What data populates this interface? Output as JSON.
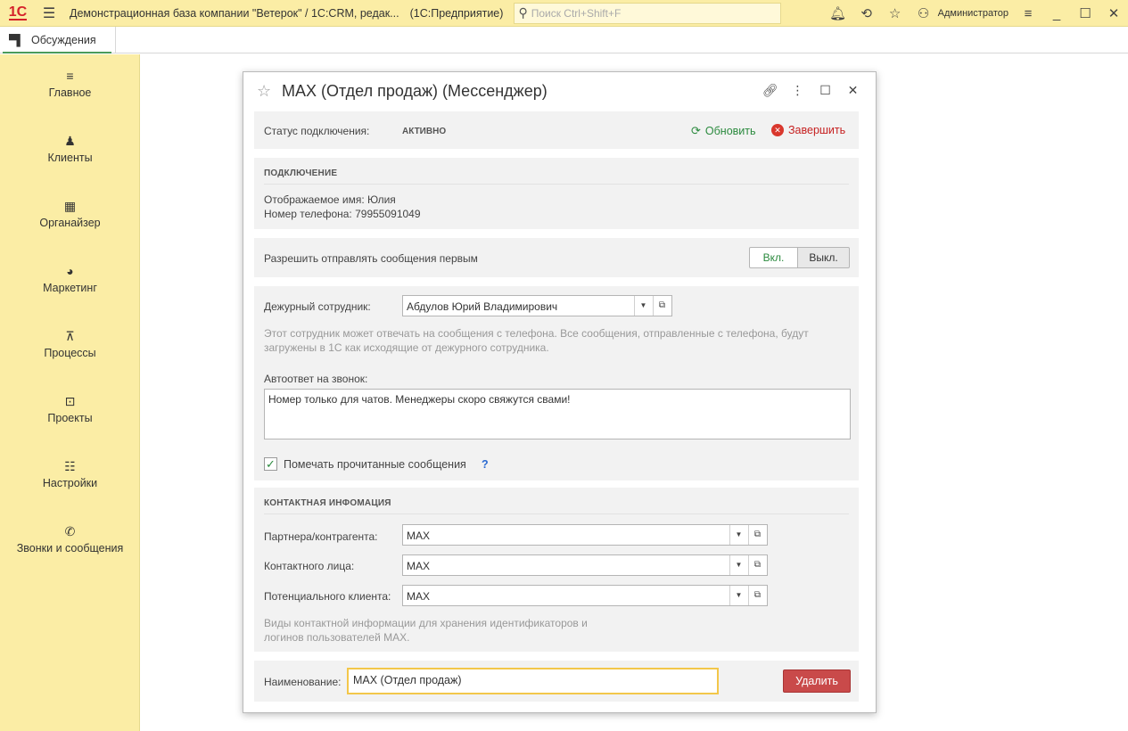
{
  "titlebar": {
    "logo": "1С",
    "title": "Демонстрационная база компании \"Ветерок\" / 1С:CRM, редак...",
    "platform": "(1С:Предприятие)",
    "search_placeholder": "Поиск Ctrl+Shift+F",
    "user": "Администратор"
  },
  "tabs": [
    {
      "label": "Обсуждения"
    }
  ],
  "sidebar": {
    "items": [
      {
        "label": "Главное",
        "icon": "menu-icon"
      },
      {
        "label": "Клиенты",
        "icon": "clients-icon"
      },
      {
        "label": "Органайзер",
        "icon": "calendar-icon"
      },
      {
        "label": "Маркетинг",
        "icon": "pie-chart-icon"
      },
      {
        "label": "Процессы",
        "icon": "process-icon"
      },
      {
        "label": "Проекты",
        "icon": "projects-icon"
      },
      {
        "label": "Настройки",
        "icon": "settings-icon"
      },
      {
        "label": "Звонки и сообщения",
        "icon": "phone-message-icon"
      }
    ]
  },
  "dialog": {
    "title": "MAX (Отдел продаж) (Мессенджер)",
    "status": {
      "label": "Статус подключения:",
      "value": "АКТИВНО",
      "refresh_label": "Обновить",
      "finish_label": "Завершить"
    },
    "connection": {
      "section_title": "ПОДКЛЮЧЕНИЕ",
      "display_name": "Отображаемое имя: Юлия",
      "phone": "Номер телефона: 79955091049"
    },
    "allow_first": {
      "label": "Разрешить отправлять сообщения первым",
      "on_label": "Вкл.",
      "off_label": "Выкл."
    },
    "duty": {
      "label": "Дежурный сотрудник:",
      "value": "Абдулов Юрий Владимирович",
      "hint_line1": "Этот сотрудник может отвечать на сообщения с телефона. Все сообщения, отправленные с телефона, будут",
      "hint_line2": "загружены в 1С как исходящие от дежурного сотрудника.",
      "autoreply_label": "Автоответ на звонок:",
      "autoreply_value": "Номер только для чатов. Менеджеры скоро свяжутся свами!",
      "mark_read_label": "Помечать прочитанные сообщения",
      "mark_read_checked": true,
      "help": "?"
    },
    "contact_info": {
      "section_title": "КОНТАКТНАЯ ИНФОМАЦИЯ",
      "partner_label": "Партнера/контрагента:",
      "partner_value": "MAX",
      "contact_label": "Контактного лица:",
      "contact_value": "MAX",
      "lead_label": "Потенциального клиента:",
      "lead_value": "MAX",
      "hint_line1": "Виды контактной информации для хранения идентификаторов и",
      "hint_line2": "логинов пользователей MAX."
    },
    "footer": {
      "name_label": "Наименование:",
      "name_value": "MAX (Отдел продаж)",
      "delete_label": "Удалить"
    }
  },
  "colors": {
    "accent_yellow": "#fbeda5",
    "green": "#2b8a3e",
    "red": "#c94a4a"
  }
}
